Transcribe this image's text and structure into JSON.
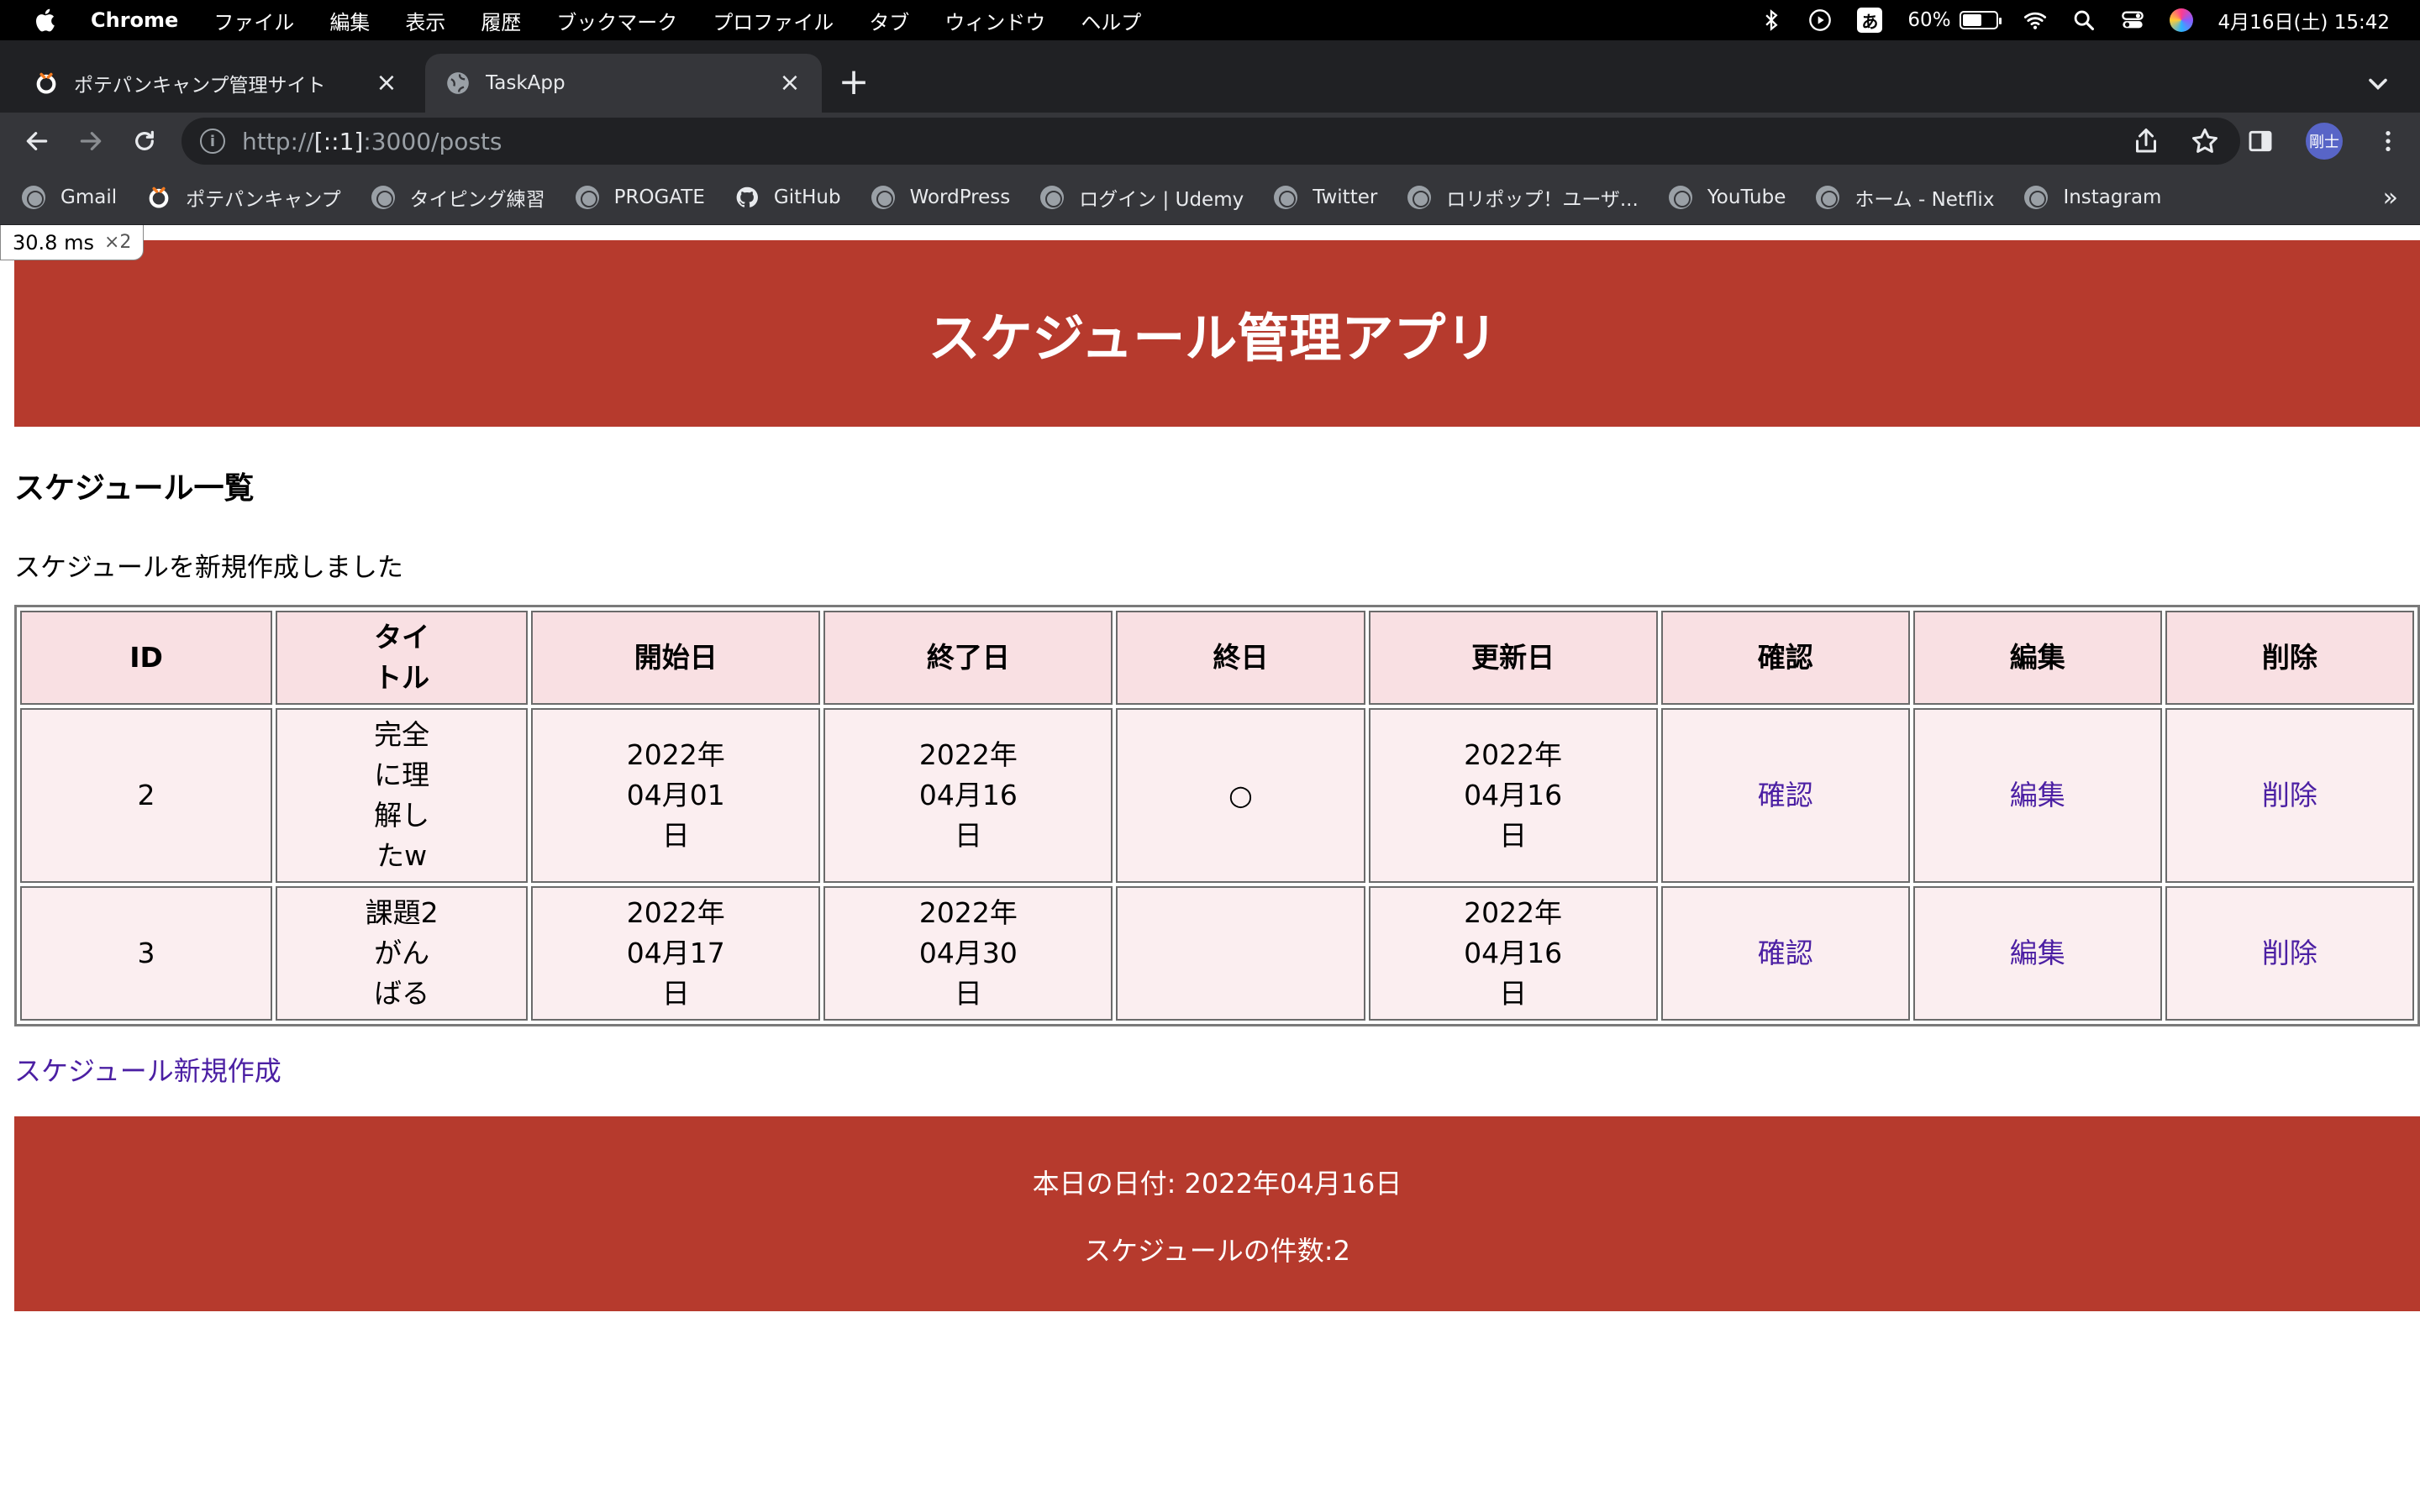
{
  "menubar": {
    "app_name": "Chrome",
    "items": [
      "ファイル",
      "編集",
      "表示",
      "履歴",
      "ブックマーク",
      "プロファイル",
      "タブ",
      "ウィンドウ",
      "ヘルプ"
    ],
    "ime": "あ",
    "battery_percent": "60%",
    "battery_level": 0.6,
    "datetime": "4月16日(土) 15:42"
  },
  "tabs": [
    {
      "title": "ポテパンキャンプ管理サイト",
      "active": false,
      "icon": "potepan-logo-icon"
    },
    {
      "title": "TaskApp",
      "active": true,
      "icon": "globe-icon"
    }
  ],
  "toolbar": {
    "url_scheme": "http://",
    "url_host": "[::1]",
    "url_rest": ":3000/posts",
    "profile_initials": "剛士"
  },
  "bookmarks": [
    {
      "label": "Gmail",
      "icon": "globe-icon"
    },
    {
      "label": "ポテパンキャンプ",
      "icon": "potepan-logo-icon"
    },
    {
      "label": "タイピング練習",
      "icon": "globe-icon"
    },
    {
      "label": "PROGATE",
      "icon": "globe-icon"
    },
    {
      "label": "GitHub",
      "icon": "github-icon"
    },
    {
      "label": "WordPress",
      "icon": "globe-icon"
    },
    {
      "label": "ログイン | Udemy",
      "icon": "globe-icon"
    },
    {
      "label": "Twitter",
      "icon": "globe-icon"
    },
    {
      "label": "ロリポップ！ユーザ...",
      "icon": "globe-icon"
    },
    {
      "label": "YouTube",
      "icon": "globe-icon"
    },
    {
      "label": "ホーム - Netflix",
      "icon": "globe-icon"
    },
    {
      "label": "Instagram",
      "icon": "globe-icon"
    }
  ],
  "perf_overlay": {
    "time": "30.8",
    "unit": "ms",
    "factor": "×2"
  },
  "page": {
    "header_title": "スケジュール管理アプリ",
    "list_heading": "スケジュール一覧",
    "notice": "スケジュールを新規作成しました",
    "table": {
      "headers": [
        "ID",
        "タイ\nトル",
        "開始日",
        "終了日",
        "終日",
        "更新日",
        "確認",
        "編集",
        "削除"
      ],
      "rows": [
        {
          "id": "2",
          "title": "完全\nに理\n解し\nたw",
          "start": "2022年\n04月01\n日",
          "end": "2022年\n04月16\n日",
          "all_day": "○",
          "updated": "2022年\n04月16\n日",
          "show": "確認",
          "edit": "編集",
          "delete": "削除"
        },
        {
          "id": "3",
          "title": "課題2\nがん\nばる",
          "start": "2022年\n04月17\n日",
          "end": "2022年\n04月30\n日",
          "all_day": "",
          "updated": "2022年\n04月16\n日",
          "show": "確認",
          "edit": "編集",
          "delete": "削除"
        }
      ]
    },
    "new_link": "スケジュール新規作成",
    "footer_date": "本日の日付: 2022年04月16日",
    "footer_count": "スケジュールの件数:2"
  },
  "colors": {
    "header_bg": "#b63a2d",
    "table_header_bg": "#f9e0e3",
    "table_cell_bg": "#fbeef0",
    "link": "#4b1fa3"
  }
}
